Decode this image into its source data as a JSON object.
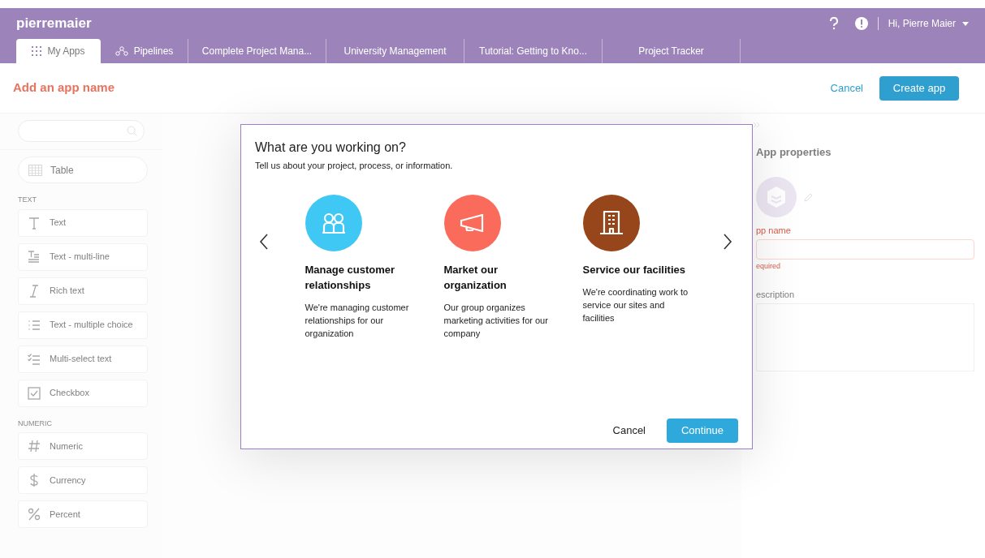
{
  "header": {
    "logo": "pierremaier",
    "user": "Hi, Pierre Maier"
  },
  "tabs": [
    {
      "label": "My Apps",
      "kind": "apps",
      "selected": true
    },
    {
      "label": "Pipelines",
      "kind": "pipelines",
      "selected": false
    },
    {
      "label": "Complete Project Mana...",
      "kind": "plain",
      "selected": false
    },
    {
      "label": "University Management",
      "kind": "plain",
      "selected": false
    },
    {
      "label": "Tutorial: Getting to Kno...",
      "kind": "plain",
      "selected": false
    },
    {
      "label": "Project Tracker",
      "kind": "plain",
      "selected": false
    }
  ],
  "subheader": {
    "title": "Add an app name",
    "cancel": "Cancel",
    "create": "Create app"
  },
  "sidebar": {
    "table_item": "Table",
    "sections": [
      {
        "title": "TEXT",
        "items": [
          {
            "label": "Text",
            "kind": "text"
          },
          {
            "label": "Text - multi-line",
            "kind": "multiline"
          },
          {
            "label": "Rich text",
            "kind": "rich"
          },
          {
            "label": "Text - multiple choice",
            "kind": "list"
          },
          {
            "label": "Multi-select text",
            "kind": "checklist"
          },
          {
            "label": "Checkbox",
            "kind": "checkbox"
          }
        ]
      },
      {
        "title": "NUMERIC",
        "items": [
          {
            "label": "Numeric",
            "kind": "hash"
          },
          {
            "label": "Currency",
            "kind": "dollar"
          },
          {
            "label": "Percent",
            "kind": "percent"
          }
        ]
      }
    ]
  },
  "properties": {
    "title": "App properties",
    "name_label": "pp name",
    "name_error": "equired",
    "description_label": "escription"
  },
  "dialog": {
    "title": "What are you working on?",
    "subtitle": "Tell us about your project, process, or information.",
    "cards": [
      {
        "kind": "people",
        "color": "#3fc8f4",
        "title": "Manage customer relationships",
        "description": "We're managing customer relationships for our organization"
      },
      {
        "kind": "megaphone",
        "color": "#fb6b5b",
        "title": "Market our organization",
        "description": "Our group organizes marketing activities for our company"
      },
      {
        "kind": "building",
        "color": "#96461a",
        "title": "Service our facilities",
        "description": "We're coordinating work to service our sites and facilities"
      }
    ],
    "cancel": "Cancel",
    "continue": "Continue"
  }
}
